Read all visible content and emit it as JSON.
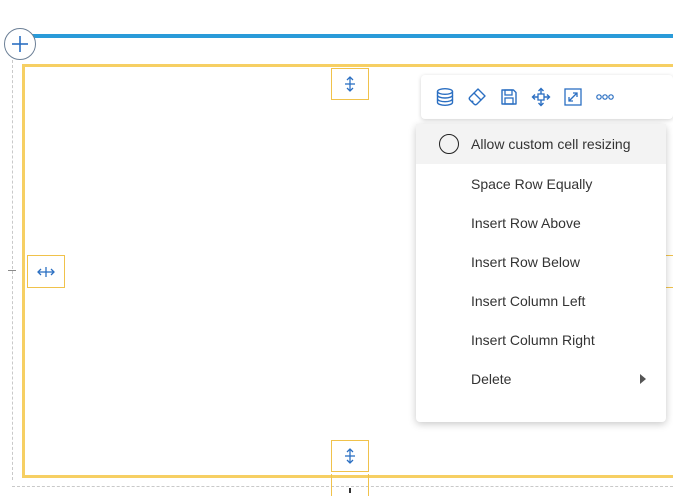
{
  "colors": {
    "accent_blue": "#2a9bd9",
    "frame_yellow": "#f6cf63",
    "icon_blue": "#2b6fc2"
  },
  "toolbar": {
    "buttons": [
      {
        "icon": "database-icon"
      },
      {
        "icon": "paint-brush-icon"
      },
      {
        "icon": "save-icon"
      },
      {
        "icon": "move-icon"
      },
      {
        "icon": "expand-icon"
      },
      {
        "icon": "more-icon"
      }
    ]
  },
  "menu": {
    "items": [
      {
        "label": "Allow custom cell resizing",
        "type": "radio",
        "checked": false
      },
      {
        "label": "Space Row Equally"
      },
      {
        "label": "Insert Row Above"
      },
      {
        "label": "Insert Row Below"
      },
      {
        "label": "Insert Column Left"
      },
      {
        "label": "Insert Column Right"
      },
      {
        "label": "Delete",
        "submenu": true
      }
    ]
  }
}
